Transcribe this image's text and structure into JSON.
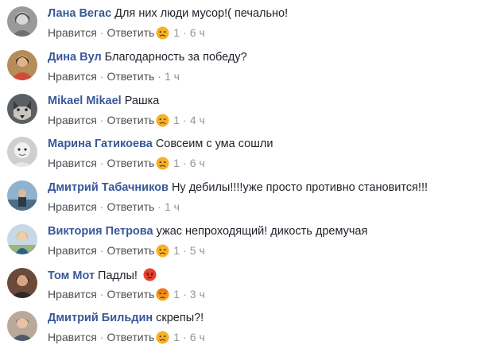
{
  "labels": {
    "like": "Нравится",
    "reply": "Ответить",
    "dot": "·"
  },
  "comments": [
    {
      "author": "Лана Вегас",
      "text": "Для них люди мусор!( печально!",
      "reaction": "sad-icon",
      "count": "1",
      "time": "6 ч"
    },
    {
      "author": "Дина Вул",
      "text": "Благодарность за победу?",
      "reaction": null,
      "count": null,
      "time": "1 ч"
    },
    {
      "author": "Mikael Mikael",
      "text": "Рашка",
      "reaction": "sad-icon",
      "count": "1",
      "time": "4 ч"
    },
    {
      "author": "Марина Гатикоева",
      "text": "Совсеим с ума сошли",
      "reaction": "sad-icon",
      "count": "1",
      "time": "6 ч"
    },
    {
      "author": "Дмитрий Табачников",
      "text": "Ну дебилы!!!!уже просто противно становится!!!",
      "reaction": null,
      "count": null,
      "time": "1 ч"
    },
    {
      "author": "Виктория Петрова",
      "text": "ужас непроходящий! дикость дремучая",
      "reaction": "sad-icon",
      "count": "1",
      "time": "5 ч"
    },
    {
      "author": "Том Мот",
      "text": "Падлы!",
      "reaction": "angry-icon",
      "count": "1",
      "time": "3 ч"
    },
    {
      "author": "Дмитрий Бильдин",
      "text": "скрепы?!",
      "reaction": "sad-icon",
      "count": "1",
      "time": "6 ч"
    }
  ],
  "colors": {
    "author": "#385898",
    "text": "#1d2129",
    "meta": "#90949c",
    "link": "#4b4f56",
    "sad_face": "#f7b125",
    "angry_face": "#e9710f",
    "inline_emoji": "#e8412c"
  }
}
